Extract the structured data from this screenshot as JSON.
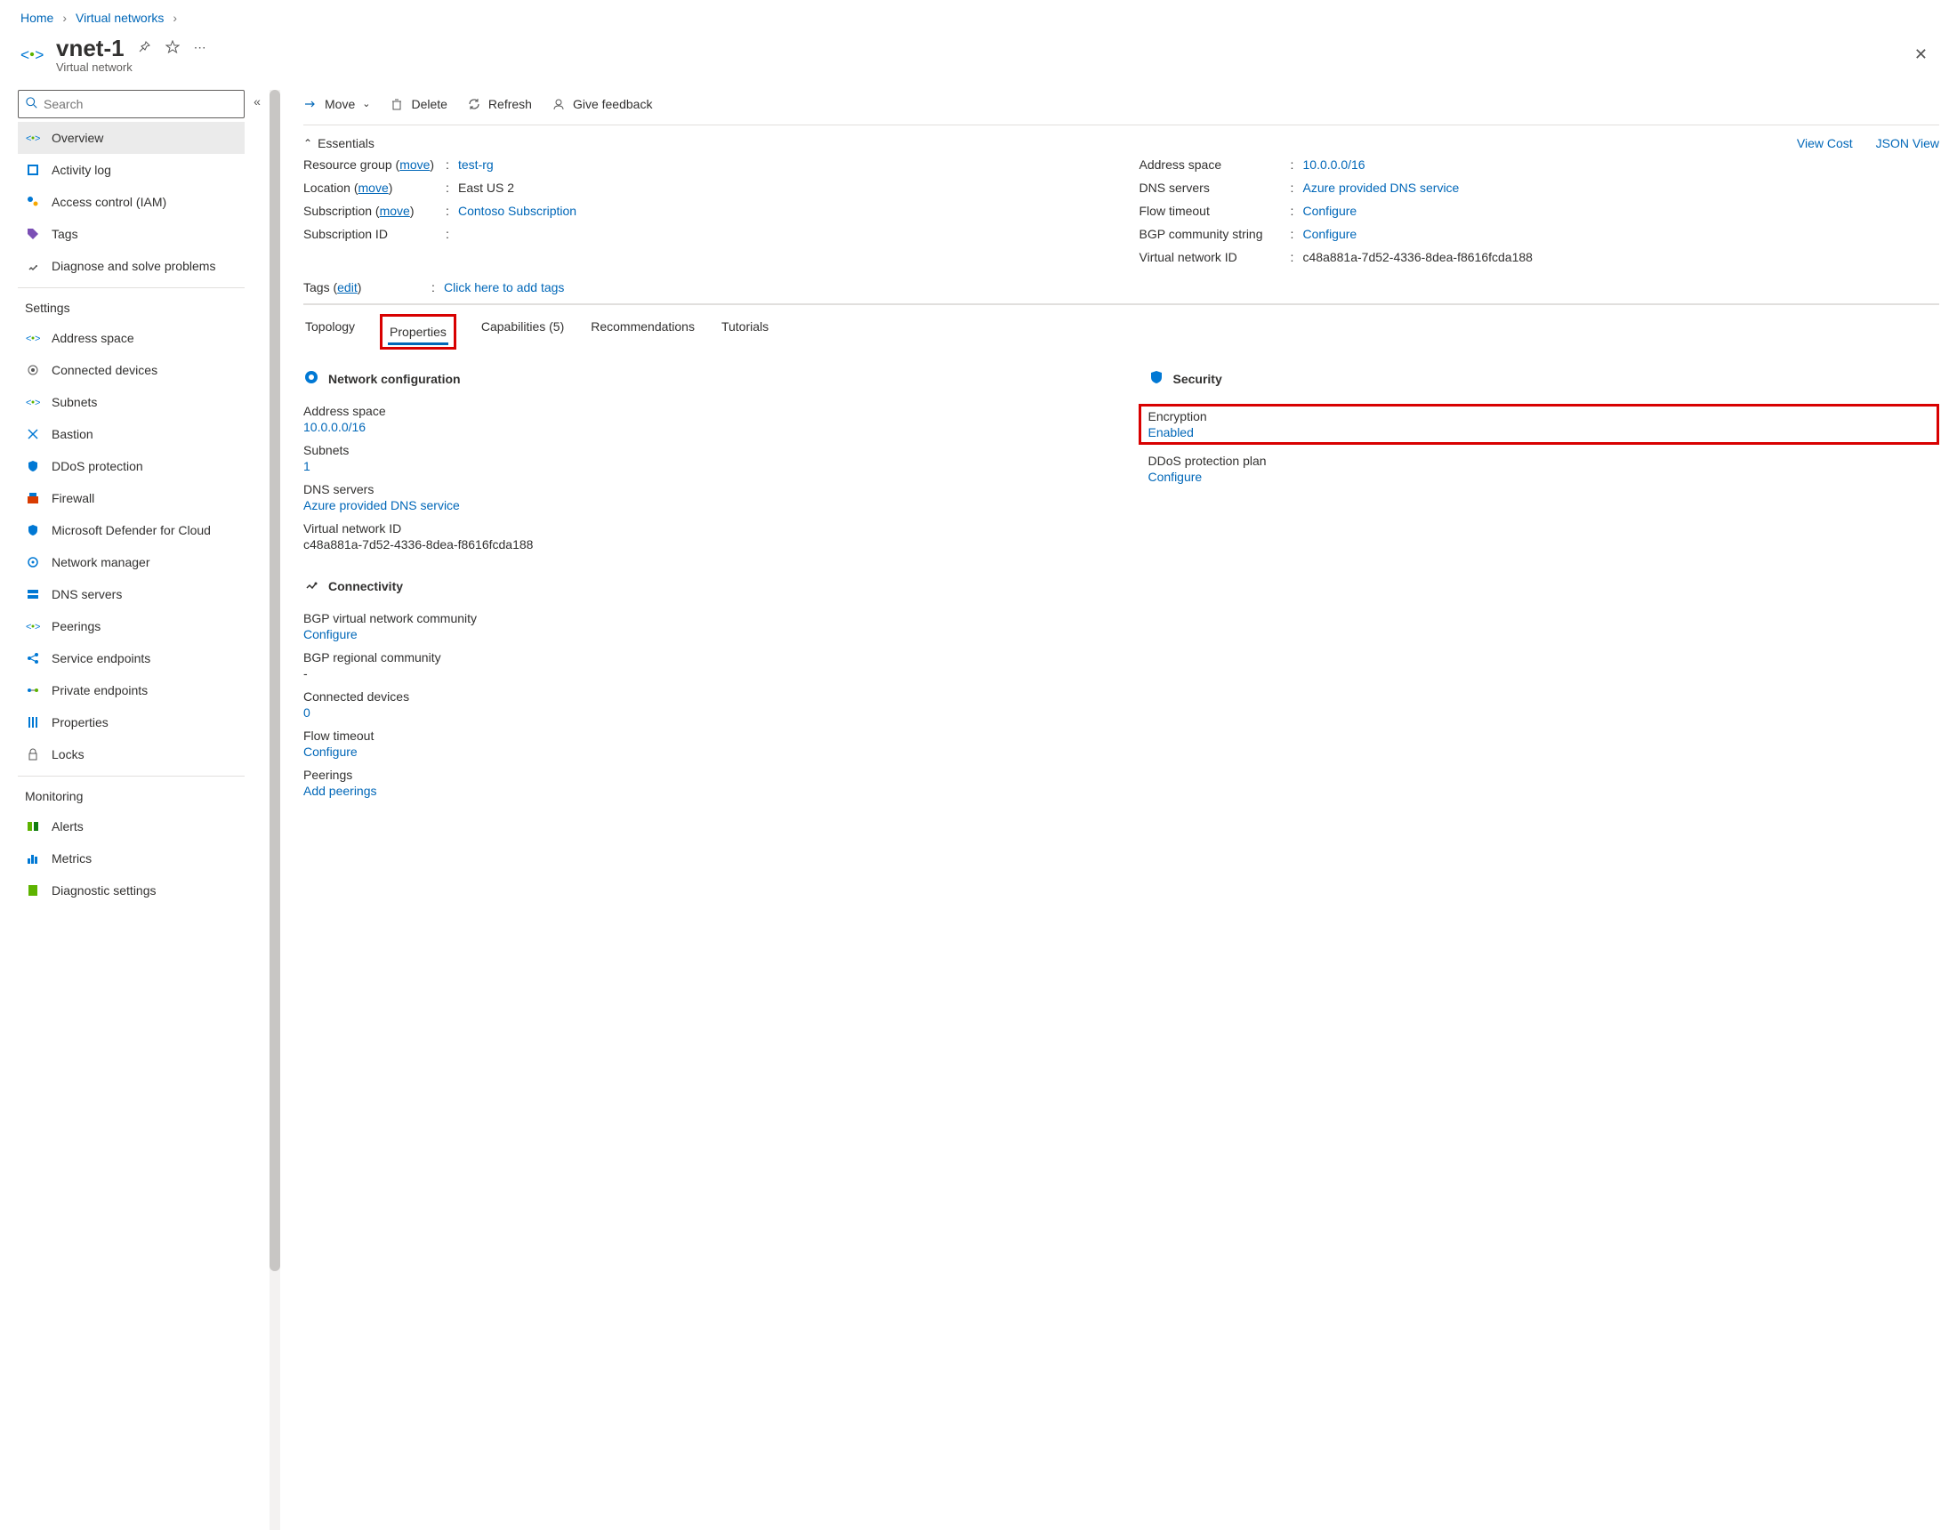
{
  "breadcrumb": {
    "home": "Home",
    "vnets": "Virtual networks"
  },
  "header": {
    "title": "vnet-1",
    "subtitle": "Virtual network"
  },
  "search": {
    "placeholder": "Search"
  },
  "sidebar": {
    "top": [
      {
        "label": "Overview"
      },
      {
        "label": "Activity log"
      },
      {
        "label": "Access control (IAM)"
      },
      {
        "label": "Tags"
      },
      {
        "label": "Diagnose and solve problems"
      }
    ],
    "settings_header": "Settings",
    "settings": [
      {
        "label": "Address space"
      },
      {
        "label": "Connected devices"
      },
      {
        "label": "Subnets"
      },
      {
        "label": "Bastion"
      },
      {
        "label": "DDoS protection"
      },
      {
        "label": "Firewall"
      },
      {
        "label": "Microsoft Defender for Cloud"
      },
      {
        "label": "Network manager"
      },
      {
        "label": "DNS servers"
      },
      {
        "label": "Peerings"
      },
      {
        "label": "Service endpoints"
      },
      {
        "label": "Private endpoints"
      },
      {
        "label": "Properties"
      },
      {
        "label": "Locks"
      }
    ],
    "monitoring_header": "Monitoring",
    "monitoring": [
      {
        "label": "Alerts"
      },
      {
        "label": "Metrics"
      },
      {
        "label": "Diagnostic settings"
      }
    ]
  },
  "cmdbar": {
    "move": "Move",
    "delete": "Delete",
    "refresh": "Refresh",
    "feedback": "Give feedback"
  },
  "essentials": {
    "title": "Essentials",
    "view_cost": "View Cost",
    "json_view": "JSON View",
    "left": {
      "resource_group_label": "Resource group",
      "resource_group_move": "move",
      "resource_group_value": "test-rg",
      "location_label": "Location",
      "location_move": "move",
      "location_value": "East US 2",
      "subscription_label": "Subscription",
      "subscription_move": "move",
      "subscription_value": "Contoso Subscription",
      "subscription_id_label": "Subscription ID",
      "subscription_id_value": ""
    },
    "right": {
      "address_space_label": "Address space",
      "address_space_value": "10.0.0.0/16",
      "dns_servers_label": "DNS servers",
      "dns_servers_value": "Azure provided DNS service",
      "flow_timeout_label": "Flow timeout",
      "flow_timeout_value": "Configure",
      "bgp_label": "BGP community string",
      "bgp_value": "Configure",
      "vnet_id_label": "Virtual network ID",
      "vnet_id_value": "c48a881a-7d52-4336-8dea-f8616fcda188"
    }
  },
  "tags": {
    "label": "Tags",
    "edit": "edit",
    "value": "Click here to add tags"
  },
  "tabs": {
    "topology": "Topology",
    "properties": "Properties",
    "capabilities": "Capabilities (5)",
    "recommendations": "Recommendations",
    "tutorials": "Tutorials"
  },
  "properties": {
    "netconfig_title": "Network configuration",
    "address_space_label": "Address space",
    "address_space_value": "10.0.0.0/16",
    "subnets_label": "Subnets",
    "subnets_value": "1",
    "dns_servers_label": "DNS servers",
    "dns_servers_value": "Azure provided DNS service",
    "vnet_id_label": "Virtual network ID",
    "vnet_id_value": "c48a881a-7d52-4336-8dea-f8616fcda188",
    "security_title": "Security",
    "encryption_label": "Encryption",
    "encryption_value": "Enabled",
    "ddos_label": "DDoS protection plan",
    "ddos_value": "Configure",
    "connectivity_title": "Connectivity",
    "bgp_virtual_label": "BGP virtual network community",
    "bgp_virtual_value": "Configure",
    "bgp_regional_label": "BGP regional community",
    "bgp_regional_value": "-",
    "connected_devices_label": "Connected devices",
    "connected_devices_value": "0",
    "flow_timeout_label": "Flow timeout",
    "flow_timeout_value": "Configure",
    "peerings_label": "Peerings",
    "peerings_value": "Add peerings"
  }
}
